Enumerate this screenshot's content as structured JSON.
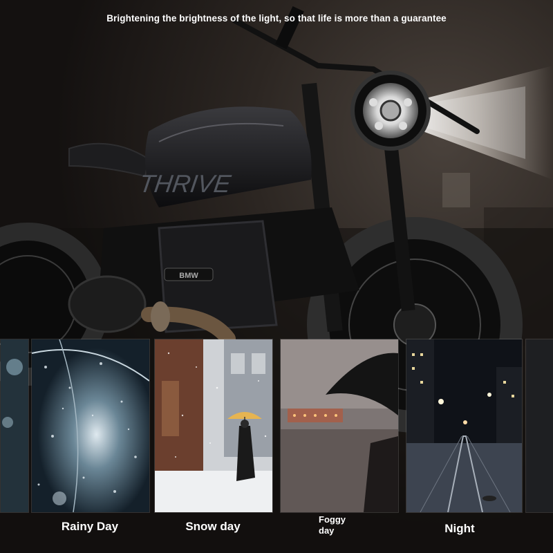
{
  "headline": "Brightening the brightness of the light, so that life is more than a guarantee",
  "hero": {
    "tank_lettering": "THRIVE",
    "engine_lettering": "BMW"
  },
  "scenes": [
    {
      "id": "rainy",
      "label": "Rainy Day"
    },
    {
      "id": "snow",
      "label": "Snow day"
    },
    {
      "id": "foggy",
      "label": "Foggy day"
    },
    {
      "id": "night",
      "label": "Night"
    }
  ],
  "colors": {
    "background": "#1a1614",
    "headlight_beam": "#fff8ee",
    "caption_text": "#ffffff"
  }
}
